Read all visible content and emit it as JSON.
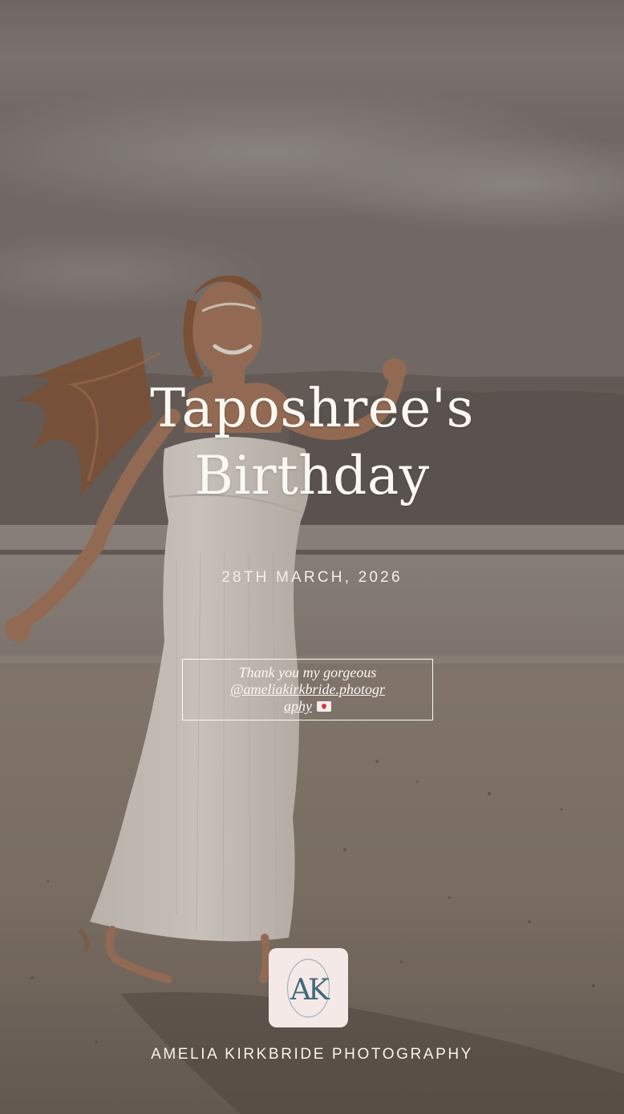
{
  "story": {
    "title_line1": "Taposhree's",
    "title_line2": "Birthday",
    "date": "28TH MARCH, 2026",
    "thanks_line1": "Thank you my gorgeous",
    "thanks_handle_part1": "@ameliakirkbride.photogr",
    "thanks_handle_part2": "aphy",
    "logo_monogram": "AK",
    "brand_name": "AMELIA KIRKBRIDE PHOTOGRAPHY"
  },
  "colors": {
    "text": "#fbf7f2",
    "logo_bg": "#f4e9e6",
    "logo_mark": "#3f6a7a",
    "heart": "#d23a4e"
  },
  "icons": {
    "heart": "love-letter-emoji-icon",
    "logo": "ak-monogram-logo"
  }
}
